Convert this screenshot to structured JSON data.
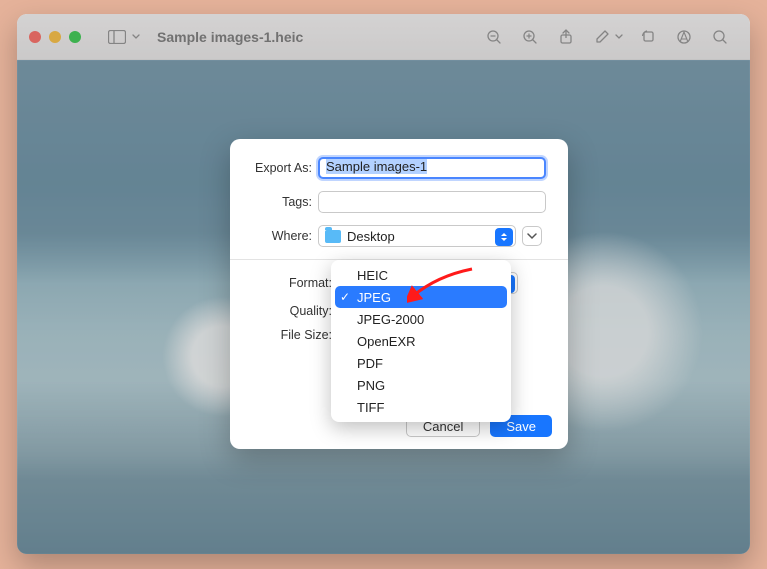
{
  "window": {
    "title": "Sample images-1.heic"
  },
  "sheet": {
    "exportAsLabel": "Export As:",
    "exportAsValue": "Sample images-1",
    "tagsLabel": "Tags:",
    "whereLabel": "Where:",
    "whereValue": "Desktop",
    "formatLabel": "Format:",
    "qualityLabel": "Quality:",
    "fileSizeLabel": "File Size:",
    "cancel": "Cancel",
    "save": "Save"
  },
  "formatMenu": {
    "items": [
      {
        "label": "HEIC",
        "selected": false
      },
      {
        "label": "JPEG",
        "selected": true
      },
      {
        "label": "JPEG-2000",
        "selected": false
      },
      {
        "label": "OpenEXR",
        "selected": false
      },
      {
        "label": "PDF",
        "selected": false
      },
      {
        "label": "PNG",
        "selected": false
      },
      {
        "label": "TIFF",
        "selected": false
      }
    ]
  }
}
